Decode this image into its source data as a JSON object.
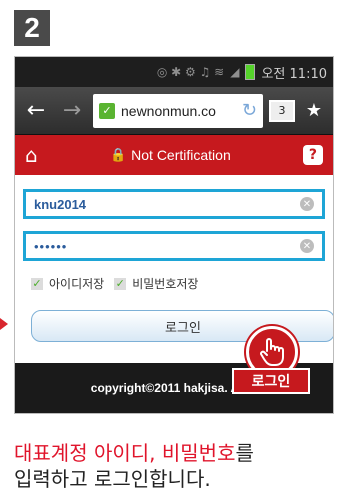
{
  "step": {
    "number": "2"
  },
  "statusbar": {
    "time": "오전 11:10"
  },
  "browser": {
    "url": "newnonmun.co",
    "tab_count": "3"
  },
  "app": {
    "title": "Not Certification",
    "help_label": "?"
  },
  "form": {
    "username_value": "knu2014",
    "password_value": "••••••",
    "save_id_label": "아이디저장",
    "save_pw_label": "비밀번호저장",
    "login_label": "로그인"
  },
  "footer": {
    "text": "copyright©2011 hakjisa. All ri"
  },
  "hint": {
    "label": "로그인"
  },
  "caption": {
    "highlight": "대표계정 아이디, 비밀번호",
    "text_1": "를",
    "text_2": "입력하고 로그인합니다."
  },
  "colors": {
    "accent_red": "#c6191e",
    "field_border": "#1ea5d6",
    "caption_highlight": "#e0142b"
  }
}
